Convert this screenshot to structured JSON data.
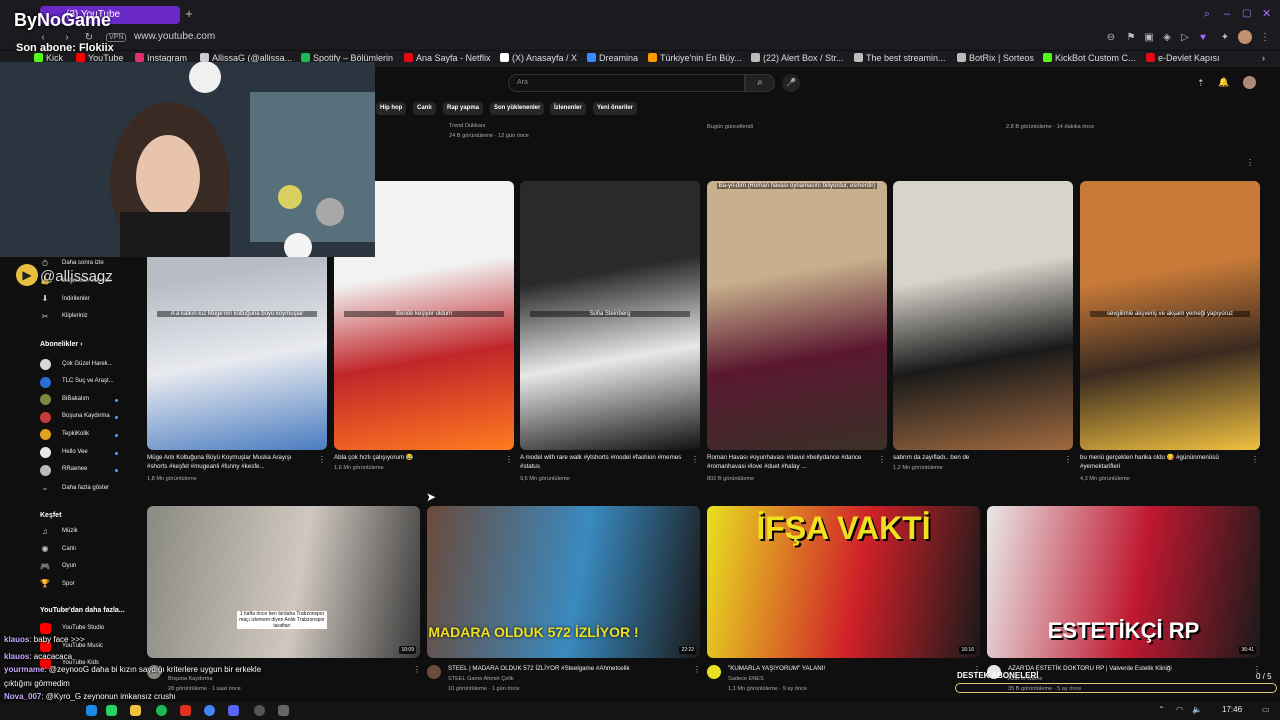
{
  "browser": {
    "tab_title": "(3) YouTube",
    "url": "www.youtube.com",
    "vpn_label": "VPN",
    "new_tab": "+",
    "time": "17:46",
    "bookmarks": [
      {
        "label": "Kick",
        "color": "#53fc18"
      },
      {
        "label": "YouTube",
        "color": "#ff0000"
      },
      {
        "label": "Instagram",
        "color": "#e1306c"
      },
      {
        "label": "AllissaG (@allissa...",
        "color": "#cccccc"
      },
      {
        "label": "Spotify – Bölümlerin",
        "color": "#1db954"
      },
      {
        "label": "Ana Sayfa - Netflix",
        "color": "#e50914"
      },
      {
        "label": "(X) Anasayfa / X",
        "color": "#ffffff"
      },
      {
        "label": "Dreamina",
        "color": "#3a8cff"
      },
      {
        "label": "Türkiye'nin En Büy...",
        "color": "#ff9900"
      },
      {
        "label": "(22) Alert Box / Str...",
        "color": "#bbbbbb"
      },
      {
        "label": "The best streamin...",
        "color": "#bbbbbb"
      },
      {
        "label": "BotRix | Sorteos",
        "color": "#bbbbbb"
      },
      {
        "label": "KickBot Custom C...",
        "color": "#53fc18"
      },
      {
        "label": "e-Devlet Kapısı",
        "color": "#e30a17"
      }
    ]
  },
  "yt": {
    "search_placeholder": "Ara",
    "chips": [
      "Hip hop",
      "Canlı",
      "Rap yapma",
      "Son yüklenenler",
      "İzlenenler",
      "Yeni öneriler"
    ],
    "top_meta": [
      {
        "line1": "Trend Dükkanı",
        "line2": "24 B görüntüleme · 12 gün önce"
      },
      {
        "line1": "Bugün güncellendi",
        "line2": ""
      },
      {
        "line1": "2,8 B görüntüleme · 14 dakika önce",
        "line2": ""
      }
    ],
    "sidebar": {
      "items": [
        {
          "label": "Daha sonra izle",
          "icon": "⏱"
        },
        {
          "label": "Beğenilen videolar",
          "icon": "👍"
        },
        {
          "label": "İndirilenler",
          "icon": "⬇"
        },
        {
          "label": "Klipleriniz",
          "icon": "✂"
        }
      ],
      "subs_title": "Abonelikler",
      "subs": [
        {
          "label": "Çok Güzel Harek...",
          "color": "#d9d9d9"
        },
        {
          "label": "TLC Suç ve Araşt...",
          "color": "#2a6fd6"
        },
        {
          "label": "BiBakalım",
          "color": "#7a8a3c"
        },
        {
          "label": "Boşuna Kaydırma",
          "color": "#c93c3c"
        },
        {
          "label": "TepkiKolik",
          "color": "#e0a020"
        },
        {
          "label": "Hello Vee",
          "color": "#e8e8e8"
        },
        {
          "label": "RRaenee",
          "color": "#bbbbbb"
        }
      ],
      "show_more": "Daha fazla göster",
      "explore_title": "Keşfet",
      "explore": [
        {
          "label": "Müzik",
          "icon": "♫"
        },
        {
          "label": "Canlı",
          "icon": "◉"
        },
        {
          "label": "Oyun",
          "icon": "🎮"
        },
        {
          "label": "Spor",
          "icon": "🏆"
        }
      ],
      "more_title": "YouTube'dan daha fazla...",
      "more": [
        {
          "label": "YouTube Studio",
          "color": "#ff0000"
        },
        {
          "label": "YouTube Music",
          "color": "#ff0000"
        },
        {
          "label": "YouTube Kids",
          "color": "#ff0000"
        }
      ]
    },
    "shorts": [
      {
        "title": "Müge Anlı Koltuğuna Büyü Koymuşlar Muska Arayışı #shorts #keşfet #mugeanli #funny #kesfe...",
        "meta": "1,8 Mn görüntüleme",
        "overlay": "A a kalkın kız Müge'nin koltuğuna büyü koymuşlar",
        "colors": [
          "#b8bcc4",
          "#e8eaf0",
          "#4a7cc0"
        ]
      },
      {
        "title": "Abla çok hızlı çalışıyorum 😂",
        "meta": "1,6 Mn görüntüleme",
        "overlay": "Bende keşiyer oldum",
        "colors": [
          "#f2f2f2",
          "#c0262a",
          "#ff7a20"
        ]
      },
      {
        "title": "A model with rare walk #ytshorts #model #fashion #memes #status",
        "meta": "9,6 Mn görüntüleme",
        "overlay": "Sofia Steinberg",
        "colors": [
          "#2a2a2a",
          "#e8e8e8",
          "#111111"
        ]
      },
      {
        "title": "Roman Havası #oyunhavası #davul #bellydance #dance #romanhavasi #love #duet #halay ...",
        "meta": "802 B görüntüleme",
        "overlay": "Ba-yıl-dım (Roman havası oynamasını biliyordur, esmerdir)",
        "colors": [
          "#c8b08c",
          "#5a1830",
          "#3a3028"
        ]
      },
      {
        "title": "sabrım da zayıfladı.. ben de",
        "meta": "1,2 Mn görüntüleme",
        "overlay": "",
        "colors": [
          "#d8d4cc",
          "#1a1a1a",
          "#a06a40"
        ]
      },
      {
        "title": "bu menü gerçekten harika oldu 😋 #gününmenüsü #yemektarifleri",
        "meta": "4,3 Mn görüntüleme",
        "overlay": "sevgilimle alışveriş ve akşam yemeği yapıyoruz",
        "colors": [
          "#c87a38",
          "#3a2a20",
          "#f0c040"
        ]
      }
    ],
    "videos": [
      {
        "title": "",
        "channel": "Boşuna Kaydırma",
        "meta": "28 görüntüleme · 1 saat önce",
        "duration": "10:09",
        "overlay": "1 hafta önce ben birdaha Trabzonspor maçı izlemem diyen Anlık Trabzonspor taraftarı",
        "colors": [
          "#8a8a80",
          "#d0c8c0",
          "#3a3a3a"
        ]
      },
      {
        "title": "STEEL | MADARA OLDUK 572 İZLİYOR #Steelgame #Ahmetcelik",
        "channel": "STEEL Game Ahmet Çelik",
        "meta": "10 görüntüleme · 1 gün önce",
        "duration": "22:22",
        "overlay": "MADARA OLDUK 572 İZLİYOR !",
        "colors": [
          "#6a4a3a",
          "#3a8ac0",
          "#1a1a1a"
        ]
      },
      {
        "title": "\"KUMARLA YAŞIYORUM\" YALANI!",
        "channel": "Sadece ENES",
        "meta": "1,1 Mn görüntüleme · 9 ay önce",
        "duration": "16:16",
        "overlay": "İFŞA VAKTİ",
        "colors": [
          "#e8e020",
          "#d02028",
          "#1a1a1a"
        ]
      },
      {
        "title": "AZAR'DA ESTETİK DOKTORU RP | Valverde Estetik Kliniği",
        "channel": "Azar Jr Game",
        "meta": "35 B görüntüleme · 5 ay önce",
        "duration": "36:41",
        "overlay": "ESTETİKÇİ RP",
        "colors": [
          "#e8e8e8",
          "#c01830",
          "#1a1a1a"
        ]
      }
    ]
  },
  "stream": {
    "brand": "ByNoGame",
    "last_sub": "Son abone: Flokiix",
    "handle": "@allissagz",
    "chat": [
      {
        "user": "klauos",
        "msg": ": baby face >>>"
      },
      {
        "user": "klauos",
        "msg": ": acacacaca"
      },
      {
        "user": "yourmame",
        "msg": ": @zeynooG daha bi kızın saydığı kriterlere uygun bir erkekle"
      },
      {
        "user": "",
        "msg": "çıktığını görmedim"
      },
      {
        "user": "Nova_007",
        "msg": ": @Kyro_G zeynonun imkansız crushı"
      },
      {
        "user": "zeynooG",
        "msg": ": yoook"
      }
    ],
    "goal_label": "DESTEK ABONELERİ",
    "goal_count": "0 / 5",
    "goal_progress": 0,
    "accent": "#6a28c9"
  }
}
